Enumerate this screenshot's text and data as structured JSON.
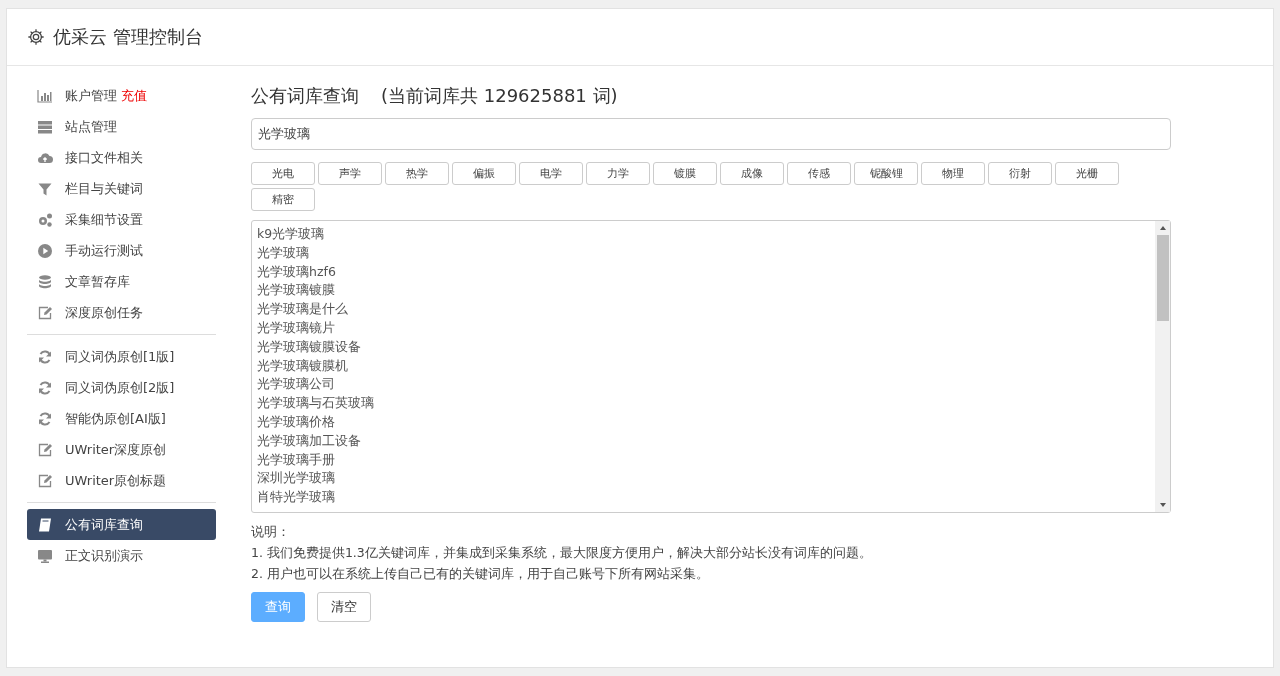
{
  "header": {
    "title": "优采云 管理控制台"
  },
  "sidebar": {
    "groups": [
      {
        "items": [
          {
            "label": "账户管理",
            "badge": "充值",
            "kind": "chart",
            "selected": false
          },
          {
            "label": "站点管理",
            "kind": "server",
            "selected": false
          },
          {
            "label": "接口文件相关",
            "kind": "cloud",
            "selected": false
          },
          {
            "label": "栏目与关键词",
            "kind": "filter",
            "selected": false
          },
          {
            "label": "采集细节设置",
            "kind": "gears",
            "selected": false
          },
          {
            "label": "手动运行测试",
            "kind": "play",
            "selected": false
          },
          {
            "label": "文章暂存库",
            "kind": "database",
            "selected": false
          },
          {
            "label": "深度原创任务",
            "kind": "edit",
            "selected": false
          }
        ]
      },
      {
        "items": [
          {
            "label": "同义词伪原创[1版]",
            "kind": "refresh",
            "selected": false
          },
          {
            "label": "同义词伪原创[2版]",
            "kind": "refresh",
            "selected": false
          },
          {
            "label": "智能伪原创[AI版]",
            "kind": "refresh",
            "selected": false
          },
          {
            "label": "UWriter深度原创",
            "kind": "edit",
            "selected": false
          },
          {
            "label": "UWriter原创标题",
            "kind": "edit",
            "selected": false
          }
        ]
      },
      {
        "items": [
          {
            "label": "公有词库查询",
            "kind": "book",
            "selected": true
          },
          {
            "label": "正文识别演示",
            "kind": "monitor",
            "selected": false
          }
        ]
      }
    ]
  },
  "main": {
    "title": "公有词库查询",
    "count_note": "(当前词库共 129625881 词)",
    "search": {
      "value": "光学玻璃"
    },
    "tags": [
      "光电",
      "声学",
      "热学",
      "偏振",
      "电学",
      "力学",
      "镀膜",
      "成像",
      "传感",
      "铌酸锂",
      "物理",
      "衍射",
      "光栅",
      "精密"
    ],
    "results": [
      "k9光学玻璃",
      "光学玻璃",
      "光学玻璃hzf6",
      "光学玻璃镀膜",
      "光学玻璃是什么",
      "光学玻璃镜片",
      "光学玻璃镀膜设备",
      "光学玻璃镀膜机",
      "光学玻璃公司",
      "光学玻璃与石英玻璃",
      "光学玻璃价格",
      "光学玻璃加工设备",
      "光学玻璃手册",
      "深圳光学玻璃",
      "肖特光学玻璃"
    ],
    "notes_title": "说明：",
    "notes": [
      "1. 我们免费提供1.3亿关键词库，并集成到采集系统，最大限度方便用户，解决大部分站长没有词库的问题。",
      "2. 用户也可以在系统上传自己已有的关键词库，用于自己账号下所有网站采集。"
    ],
    "buttons": [
      {
        "label": "查询",
        "kind": "primary"
      },
      {
        "label": "清空",
        "kind": "default"
      }
    ]
  }
}
